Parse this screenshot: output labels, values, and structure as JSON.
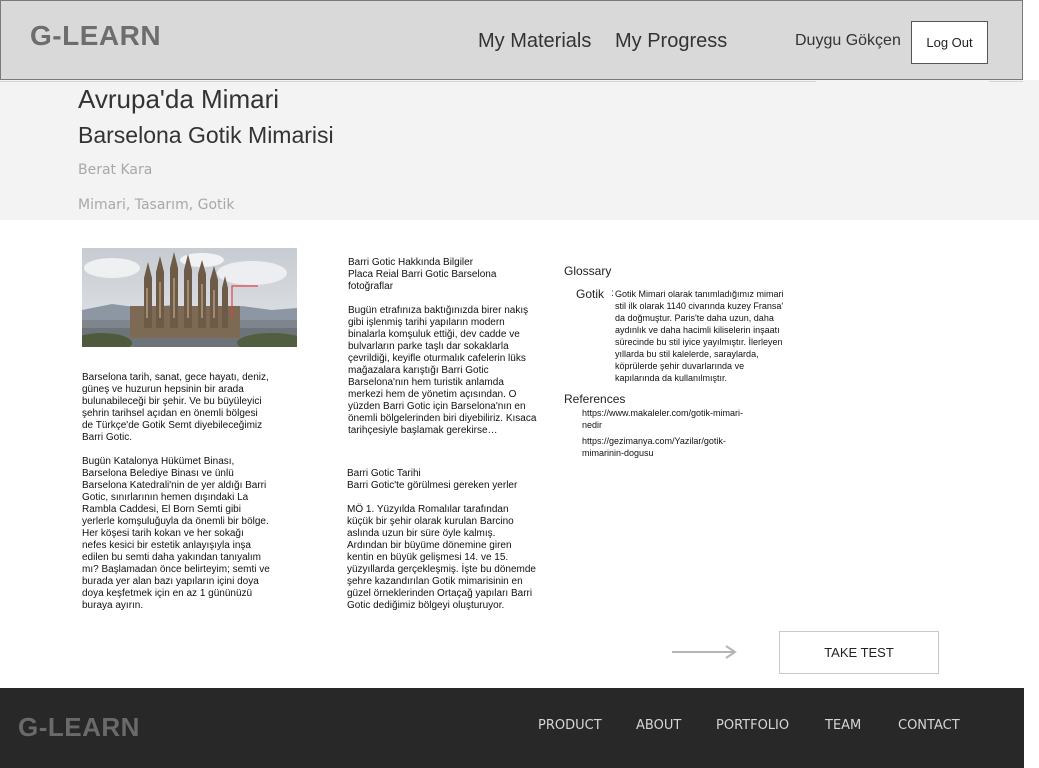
{
  "header": {
    "logo": "G-LEARN",
    "nav": {
      "materials": "My Materials",
      "progress": "My Progress"
    },
    "user_name": "Duygu Gökçen",
    "logout_label": "Log Out"
  },
  "banner": {
    "course_title": "Avrupa'da Mimari",
    "lesson_title": "Barselona Gotik Mimarisi",
    "author": "Berat Kara",
    "tags": "Mimari, Tasarım, Gotik"
  },
  "content": {
    "col1": {
      "p1": "Barselona tarih, sanat, gece hayatı, deniz,\ngüneş ve huzurun hepsinin bir arada\nbulunabileceği bir şehir. Ve bu büyüleyici\nşehrin tarihsel açıdan en önemli bölgesi\nde Türkçe'de Gotik Semt diyebileceğimiz\nBarri Gotic.",
      "p2": "Bugün Katalonya Hükümet Binası,\nBarselona Belediye Binası ve ünlü\nBarselona Katedrali'nin de yer aldığı Barri\nGotic, sınırlarının hemen dışındaki La\nRambla Caddesi, El Born Semti gibi\nyerlerle komşuluğuyla da önemli bir bölge.\nHer köşesi tarih kokan ve her sokağı\nnefes kesici bir estetik anlayışıyla inşa\nedilen bu semti daha yakından tanıyalım\nmı? Başlamadan önce belirteyim; semti ve\nburada yer alan bazı yapıların içini doya\ndoya keşfetmek için en az 1 gününüzü\nburaya ayırın."
    },
    "col2": {
      "h1": "Barri Gotic Hakkında Bilgiler\nPlaca Reial Barri Gotic Barselona\nfotoğraflar",
      "p1": "Bugün etrafınıza baktığınızda birer nakış\ngibi işlenmiş tarihi yapıların modern\nbinalarla komşuluk ettiği, dev cadde ve\nbulvarların parke taşlı dar sokaklarla\nçevrildiği, keyifle oturmalık cafelerin lüks\nmağazalara karıştığı Barri Gotic\nBarselona'nın hem turistik anlamda\nmerkezi hem de yönetim açısından. O\nyüzden Barri Gotic için Barselona'nın en\nönemli bölgelerinden biri diyebiliriz. Kısaca\ntarihçesiyle başlamak gerekirse…",
      "h2": "Barri Gotic Tarihi\nBarri Gotic'te görülmesi gereken yerler",
      "p2": "MÖ 1. Yüzyılda Romalılar tarafından\nküçük bir şehir olarak kurulan Barcino\naslında uzun bir süre öyle kalmış.\nArdından bir büyüme dönemine giren\nkentin en büyük gelişmesi 14. ve 15.\nyüzyıllarda gerçekleşmiş. İşte bu dönemde\nşehre kazandırılan Gotik mimarisinin en\ngüzel örneklerinden Ortaçağ yapıları Barri\nGotic dediğimiz bölgeyi oluşturuyor."
    },
    "glossary": {
      "title": "Glossary",
      "term": "Gotik",
      "colon": ":",
      "definition": "Gotik Mimari olarak tanımladığımız mimari\nstil ilk olarak 1140 civarında kuzey Fransa'\nda doğmuştur. Paris'te daha uzun, daha\naydınlık ve daha hacimli kiliselerin inşaatı\nsürecinde bu stil iyice yayılmıştır. İlerleyen\nyıllarda bu stil kalelerde, saraylarda,\nköprülerde şehir duvarlarında ve\nkapılarında da kullanılmıştır."
    },
    "references": {
      "title": "References",
      "links": [
        "https://www.makaleler.com/gotik-mimari-\nnedir",
        "https://gezimanya.com/Yazilar/gotik-\nmimarinin-dogusu"
      ]
    }
  },
  "actions": {
    "take_test_label": "TAKE TEST"
  },
  "footer": {
    "logo": "G-LEARN",
    "links": [
      "PRODUCT",
      "ABOUT",
      "PORTFOLIO",
      "TEAM",
      "CONTACT"
    ]
  },
  "colors": {
    "header_bg": "#d9d9d9",
    "banner_bg": "#f3f3f3",
    "footer_bg": "#282828",
    "muted_text": "#a8a8a8"
  }
}
